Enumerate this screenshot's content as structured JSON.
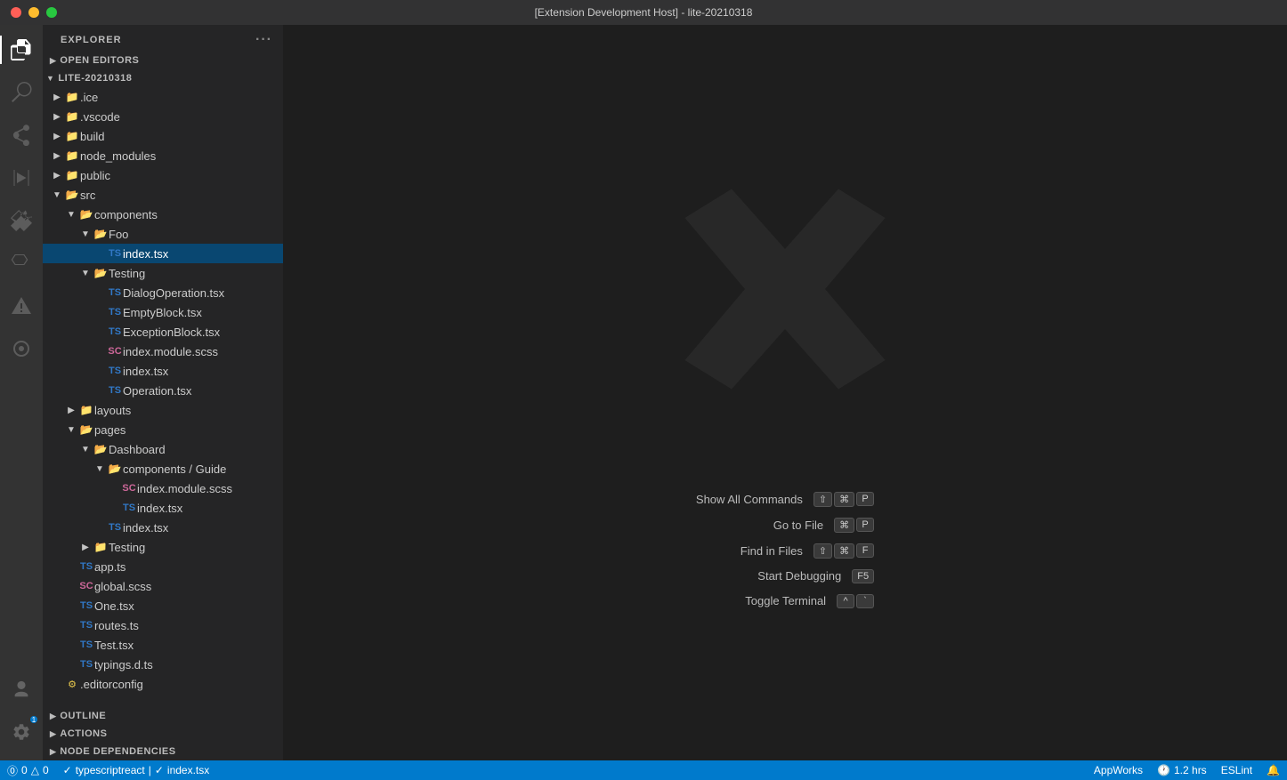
{
  "titlebar": {
    "title": "[Extension Development Host] - lite-20210318"
  },
  "activitybar": {
    "icons": [
      {
        "name": "explorer-icon",
        "symbol": "⎘",
        "active": true
      },
      {
        "name": "search-icon",
        "symbol": "🔍",
        "active": false
      },
      {
        "name": "source-control-icon",
        "symbol": "⑂",
        "active": false
      },
      {
        "name": "run-icon",
        "symbol": "▷",
        "active": false
      },
      {
        "name": "extensions-icon",
        "symbol": "⧉",
        "active": false
      },
      {
        "name": "testing-icon",
        "symbol": "⚗",
        "active": false
      },
      {
        "name": "problems-icon",
        "symbol": "△",
        "active": false
      },
      {
        "name": "remote-icon",
        "symbol": "⊙",
        "active": false
      }
    ],
    "bottom": [
      {
        "name": "accounts-icon",
        "symbol": "◯"
      },
      {
        "name": "settings-icon",
        "symbol": "⚙",
        "badge": "1"
      }
    ]
  },
  "sidebar": {
    "header": "Explorer",
    "sections": {
      "open_editors": "Open Editors",
      "project": "LITE-20210318",
      "outline": "Outline",
      "actions": "Actions",
      "node_deps": "Node Dependencies"
    },
    "tree": [
      {
        "id": "ice",
        "label": ".ice",
        "type": "folder",
        "depth": 0,
        "collapsed": true
      },
      {
        "id": "vscode",
        "label": ".vscode",
        "type": "folder",
        "depth": 0,
        "collapsed": true
      },
      {
        "id": "build",
        "label": "build",
        "type": "folder",
        "depth": 0,
        "collapsed": true
      },
      {
        "id": "node_modules",
        "label": "node_modules",
        "type": "folder",
        "depth": 0,
        "collapsed": true
      },
      {
        "id": "public",
        "label": "public",
        "type": "folder",
        "depth": 0,
        "collapsed": true
      },
      {
        "id": "src",
        "label": "src",
        "type": "folder",
        "depth": 0,
        "expanded": true
      },
      {
        "id": "components",
        "label": "components",
        "type": "folder",
        "depth": 1,
        "expanded": true
      },
      {
        "id": "Foo",
        "label": "Foo",
        "type": "folder",
        "depth": 2,
        "expanded": true
      },
      {
        "id": "foo-index",
        "label": "index.tsx",
        "type": "ts",
        "depth": 3,
        "selected": true
      },
      {
        "id": "Testing",
        "label": "Testing",
        "type": "folder",
        "depth": 2,
        "expanded": true
      },
      {
        "id": "DialogOperation",
        "label": "DialogOperation.tsx",
        "type": "ts",
        "depth": 3
      },
      {
        "id": "EmptyBlock",
        "label": "EmptyBlock.tsx",
        "type": "ts",
        "depth": 3
      },
      {
        "id": "ExceptionBlock",
        "label": "ExceptionBlock.tsx",
        "type": "ts",
        "depth": 3
      },
      {
        "id": "index-module-scss",
        "label": "index.module.scss",
        "type": "scss",
        "depth": 3
      },
      {
        "id": "testing-index",
        "label": "index.tsx",
        "type": "ts",
        "depth": 3
      },
      {
        "id": "Operation",
        "label": "Operation.tsx",
        "type": "ts",
        "depth": 3
      },
      {
        "id": "layouts",
        "label": "layouts",
        "type": "folder",
        "depth": 1,
        "collapsed": true
      },
      {
        "id": "pages",
        "label": "pages",
        "type": "folder",
        "depth": 1,
        "expanded": true
      },
      {
        "id": "Dashboard",
        "label": "Dashboard",
        "type": "folder",
        "depth": 2,
        "expanded": true
      },
      {
        "id": "components-guide",
        "label": "components / Guide",
        "type": "folder",
        "depth": 3,
        "expanded": true
      },
      {
        "id": "guide-scss",
        "label": "index.module.scss",
        "type": "scss",
        "depth": 4
      },
      {
        "id": "guide-index",
        "label": "index.tsx",
        "type": "ts",
        "depth": 4
      },
      {
        "id": "dashboard-index",
        "label": "index.tsx",
        "type": "ts",
        "depth": 3
      },
      {
        "id": "pages-Testing",
        "label": "Testing",
        "type": "folder",
        "depth": 2,
        "collapsed": true
      },
      {
        "id": "app-ts",
        "label": "app.ts",
        "type": "ts",
        "depth": 1
      },
      {
        "id": "global-scss",
        "label": "global.scss",
        "type": "scss",
        "depth": 1
      },
      {
        "id": "One-tsx",
        "label": "One.tsx",
        "type": "ts",
        "depth": 1
      },
      {
        "id": "routes-ts",
        "label": "routes.ts",
        "type": "ts",
        "depth": 1
      },
      {
        "id": "Test-tsx",
        "label": "Test.tsx",
        "type": "ts",
        "depth": 1
      },
      {
        "id": "typings-d-ts",
        "label": "typings.d.ts",
        "type": "ts",
        "depth": 1
      },
      {
        "id": "editorconfig",
        "label": ".editorconfig",
        "type": "config",
        "depth": 0
      }
    ]
  },
  "editor": {
    "shortcuts": [
      {
        "label": "Show All Commands",
        "keys": [
          "⇧",
          "⌘",
          "P"
        ]
      },
      {
        "label": "Go to File",
        "keys": [
          "⌘",
          "P"
        ]
      },
      {
        "label": "Find in Files",
        "keys": [
          "⇧",
          "⌘",
          "F"
        ]
      },
      {
        "label": "Start Debugging",
        "keys": [
          "F5"
        ]
      },
      {
        "label": "Toggle Terminal",
        "keys": [
          "^",
          "`"
        ]
      }
    ]
  },
  "statusbar": {
    "left": [
      {
        "id": "remote",
        "text": "⓪ 0  △ 0"
      },
      {
        "id": "branch",
        "text": "✓ typescriptreact | ✓ index.tsx"
      }
    ],
    "right": [
      {
        "id": "appworks",
        "text": "AppWorks"
      },
      {
        "id": "time",
        "text": "🕐 1.2 hrs"
      },
      {
        "id": "eslint",
        "text": "ESLint"
      },
      {
        "id": "bell",
        "text": "🔔"
      }
    ]
  }
}
